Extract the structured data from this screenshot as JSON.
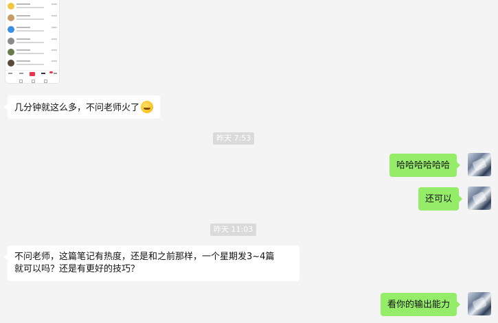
{
  "thumbnail": {
    "rows": [
      {
        "avatar_color": "#f5c542"
      },
      {
        "avatar_color": "#c89a6a"
      },
      {
        "avatar_color": "#3a8ee6"
      },
      {
        "avatar_color": "#8a8a8a"
      },
      {
        "avatar_color": "#6a7a4a"
      },
      {
        "avatar_color": "#5a4a3a"
      }
    ]
  },
  "messages": {
    "m1": {
      "text": "几分钟就这么多，不问老师火了",
      "emoji": "laughing-crying-emoji"
    },
    "ts1": "昨天 7:53",
    "m2": {
      "text": "哈哈哈哈哈哈"
    },
    "m3": {
      "text": "还可以"
    },
    "ts2": "昨天 11:03",
    "m4": {
      "line1": "不问老师，这篇笔记有热度，还是和之前那样，一个星期发3~4篇",
      "line2": "就可以吗？还是有更好的技巧？"
    },
    "m5": {
      "text": "看你的输出能力"
    }
  },
  "colors": {
    "background": "#f4f4f4",
    "sent_bubble": "#95ec69",
    "received_bubble": "#ffffff",
    "timestamp_bg": "#dadada"
  }
}
